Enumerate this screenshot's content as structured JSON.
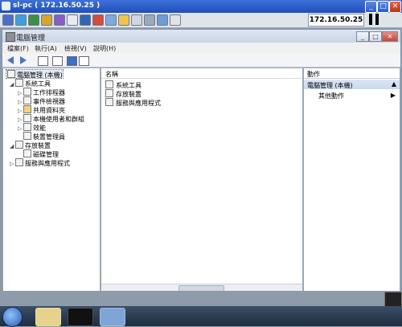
{
  "rdp": {
    "title": "sl-pc ( 172.16.50.25 )",
    "ip": "172.16.50.25"
  },
  "window": {
    "title": "電腦管理"
  },
  "menu": [
    "檔案(F)",
    "執行(A)",
    "檢視(V)",
    "說明(H)"
  ],
  "tree": {
    "root": "電腦管理 (本機)",
    "items": [
      {
        "label": "系統工具",
        "level": 1,
        "expander": "◢"
      },
      {
        "label": "工作排程器",
        "level": 2,
        "expander": "▷"
      },
      {
        "label": "事件檢視器",
        "level": 2,
        "expander": "▷"
      },
      {
        "label": "共用資料夾",
        "level": 2,
        "expander": "▷"
      },
      {
        "label": "本機使用者和群組",
        "level": 2,
        "expander": "▷"
      },
      {
        "label": "效能",
        "level": 2,
        "expander": "▷"
      },
      {
        "label": "裝置管理員",
        "level": 2,
        "expander": ""
      },
      {
        "label": "存放裝置",
        "level": 1,
        "expander": "◢"
      },
      {
        "label": "磁碟管理",
        "level": 2,
        "expander": ""
      },
      {
        "label": "服務與應用程式",
        "level": 1,
        "expander": "▷"
      }
    ]
  },
  "list": {
    "header": "名稱",
    "items": [
      "系統工具",
      "存放裝置",
      "服務與應用程式"
    ]
  },
  "actions": {
    "header": "動作",
    "section": "電腦管理 (本機)",
    "more": "其他動作"
  }
}
